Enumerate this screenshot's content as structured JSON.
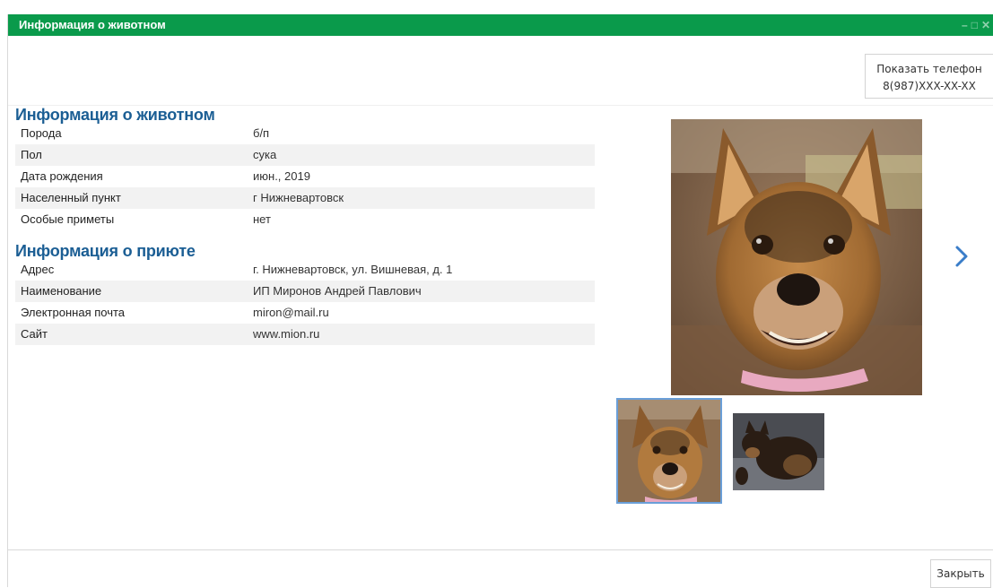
{
  "window": {
    "title": "Информация о животном",
    "controls": {
      "minimize": "–",
      "maximize": "□",
      "close": "✕"
    }
  },
  "phone_button": {
    "line1": "Показать телефон",
    "line2": "8(987)XXX-XX-XX"
  },
  "animal_section": {
    "title": "Информация о животном",
    "rows": [
      {
        "label": "Порода",
        "value": "б/п"
      },
      {
        "label": "Пол",
        "value": "сука"
      },
      {
        "label": "Дата рождения",
        "value": "июн., 2019"
      },
      {
        "label": "Населенный пункт",
        "value": "г Нижневартовск"
      },
      {
        "label": "Особые приметы",
        "value": "нет"
      }
    ]
  },
  "shelter_section": {
    "title": "Информация о приюте",
    "rows": [
      {
        "label": "Адрес",
        "value": "г. Нижневартовск, ул. Вишневая, д. 1"
      },
      {
        "label": "Наименование",
        "value": "ИП Миронов Андрей Павлович"
      },
      {
        "label": "Электронная почта",
        "value": "miron@mail.ru"
      },
      {
        "label": "Сайт",
        "value": "www.mion.ru"
      }
    ]
  },
  "gallery": {
    "next_icon": "chevron-right-icon",
    "selected_thumbnail": 1,
    "thumbnail_count": 2
  },
  "footer": {
    "close_label": "Закрыть"
  },
  "colors": {
    "titlebar": "#0a9a4b",
    "section_title": "#1b5e94",
    "thumb_selected_border": "#6a9fd8",
    "arrow": "#3a7dc9"
  }
}
